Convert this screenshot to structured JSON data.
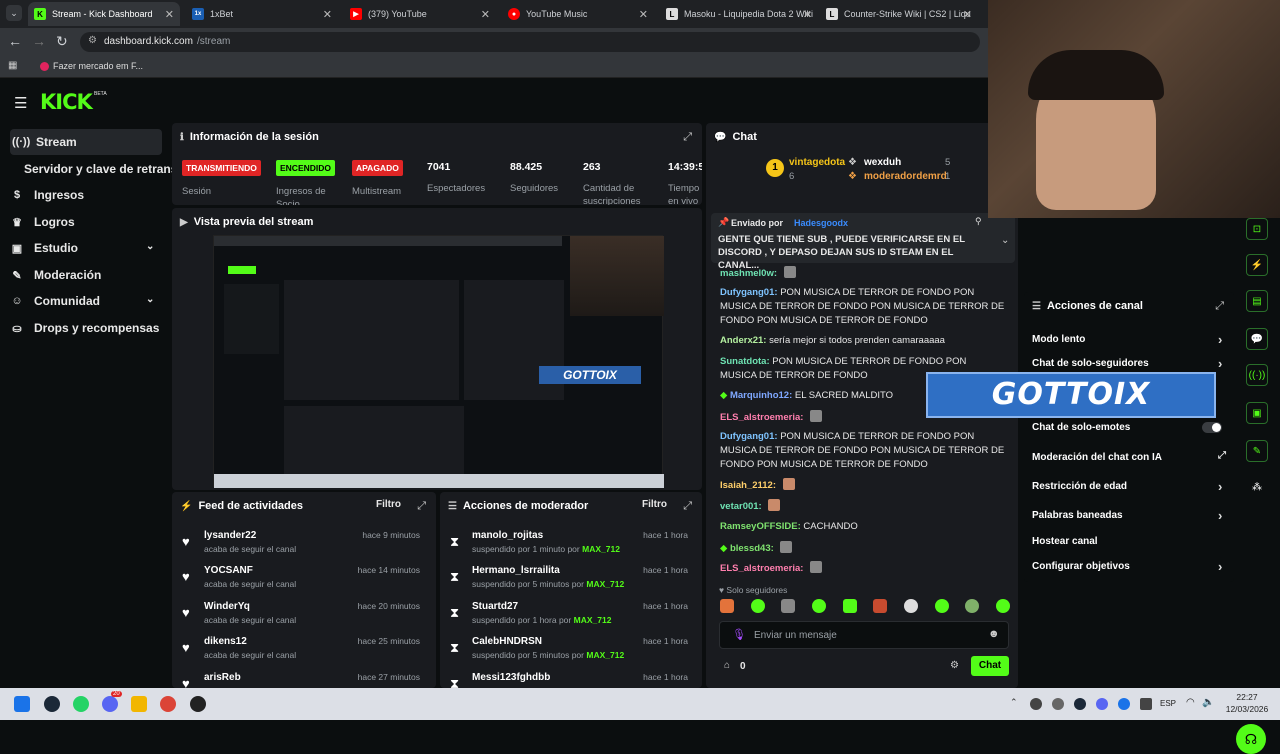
{
  "browser": {
    "tabs": [
      {
        "label": "Stream - Kick Dashboard",
        "fav_color": "#53fc18",
        "fav": "K"
      },
      {
        "label": "1xBet",
        "fav_color": "#1a5fb4",
        "fav": "1x"
      },
      {
        "label": "(379) YouTube",
        "fav_color": "#ff0000",
        "fav": "▶"
      },
      {
        "label": "YouTube Music",
        "fav_color": "#ff0000",
        "fav": "●"
      },
      {
        "label": "Masoku - Liquipedia Dota 2 Wiki",
        "fav_color": "#ddd",
        "fav": "L"
      },
      {
        "label": "Counter-Strike Wiki | CS2 | Liqu",
        "fav_color": "#ddd",
        "fav": "L"
      }
    ],
    "address_host": "dashboard.kick.com",
    "address_path": "/stream",
    "bookmark": "Fazer mercado em F..."
  },
  "brand": {
    "logo": "KICK",
    "beta": "BETA"
  },
  "sidebar": {
    "items": [
      {
        "label": "Stream",
        "icon": "radio-icon"
      },
      {
        "label": "Servidor y clave de retransmisión"
      },
      {
        "label": "Ingresos",
        "icon": "money-icon"
      },
      {
        "label": "Logros",
        "icon": "trophy-icon"
      },
      {
        "label": "Estudio",
        "icon": "studio-icon"
      },
      {
        "label": "Moderación",
        "icon": "wrench-icon"
      },
      {
        "label": "Comunidad",
        "icon": "community-icon"
      },
      {
        "label": "Drops y recompensas",
        "icon": "drops-icon"
      }
    ]
  },
  "session": {
    "title": "Información de la sesión",
    "badges": [
      {
        "label": "TRANSMITIENDO",
        "sub": "Sesión",
        "bg": "#e02525",
        "fg": "#ffffff"
      },
      {
        "label": "ENCENDIDO",
        "sub": "Ingresos de Socio",
        "bg": "#53fc18",
        "fg": "#000000"
      },
      {
        "label": "APAGADO",
        "sub": "Multistream",
        "bg": "#e02525",
        "fg": "#ffffff"
      }
    ],
    "stats": [
      {
        "value": "7041",
        "label": "Espectadores"
      },
      {
        "value": "88.425",
        "label": "Seguidores"
      },
      {
        "value": "263",
        "label": "Cantidad de suscripciones"
      },
      {
        "value": "14:39:5",
        "label": "Tiempo en vivo"
      }
    ]
  },
  "preview": {
    "title": "Vista previa del stream",
    "overlay": "GOTTOIX"
  },
  "feed": {
    "title": "Feed de actividades",
    "filter": "Filtro",
    "rows": [
      {
        "name": "lysander22",
        "sub": "acaba de seguir el canal",
        "time": "hace 9 minutos"
      },
      {
        "name": "YOCSANF",
        "sub": "acaba de seguir el canal",
        "time": "hace 14 minutos"
      },
      {
        "name": "WinderYq",
        "sub": "acaba de seguir el canal",
        "time": "hace 20 minutos"
      },
      {
        "name": "dikens12",
        "sub": "acaba de seguir el canal",
        "time": "hace 25 minutos"
      },
      {
        "name": "arisReb",
        "sub": "",
        "time": "hace 27 minutos"
      }
    ]
  },
  "mod": {
    "title": "Acciones de moderador",
    "filter": "Filtro",
    "rows": [
      {
        "name": "manolo_rojitas",
        "sub": "suspendido por 1 minuto por",
        "by": "MAX_712",
        "time": "hace 1 hora"
      },
      {
        "name": "Hermano_lsrrailita",
        "sub": "suspendido por 5 minutos por",
        "by": "MAX_712",
        "time": "hace 1 hora"
      },
      {
        "name": "Stuartd27",
        "sub": "suspendido por 1 hora por",
        "by": "MAX_712",
        "time": "hace 1 hora"
      },
      {
        "name": "CalebHNDRSN",
        "sub": "suspendido por 5 minutos por",
        "by": "MAX_712",
        "time": "hace 1 hora"
      },
      {
        "name": "Messi123fghdbb",
        "sub": "",
        "by": "",
        "time": "hace 1 hora"
      }
    ]
  },
  "chat": {
    "title": "Chat",
    "top": {
      "rank": "1",
      "user1": "vintagedota",
      "user1_count": "6",
      "user2": "wexduh",
      "user2_count": "5",
      "user3": "moderadordemrd",
      "user3_count": "1"
    },
    "pinned": {
      "by_label": "Enviado por",
      "by_user": "Hadesgoodx",
      "text": "GENTE QUE TIENE SUB , PUEDE VERIFICARSE EN EL DISCORD , Y DEPASO DEJAN SUS ID STEAM EN EL CANAL..."
    },
    "messages": [
      {
        "user": "mashmel0w:",
        "color": "#6fe3b3",
        "text": ""
      },
      {
        "user": "Dufygang01:",
        "color": "#7fc4ff",
        "text": "PON MUSICA DE TERROR DE FONDO  PON MUSICA DE TERROR DE FONDO  PON MUSICA DE TERROR DE FONDO  PON MUSICA DE TERROR DE FONDO"
      },
      {
        "user": "Anderx21:",
        "color": "#b4f0a0",
        "text": "sería mejor si todos prenden camaraaaaa"
      },
      {
        "user": "Sunatdota:",
        "color": "#6fe3b3",
        "text": "PON MUSICA DE TERROR DE FONDO    PON MUSICA DE TERROR DE FONDO"
      },
      {
        "user": "Marquinho12:",
        "color": "#7fa8ff",
        "text": "EL SACRED MALDITO"
      },
      {
        "user": "ELS_alstroemeria:",
        "color": "#ff7fae",
        "text": ""
      },
      {
        "user": "Dufygang01:",
        "color": "#7fc4ff",
        "text": "PON MUSICA DE TERROR DE FONDO  PON MUSICA DE TERROR DE FONDO  PON MUSICA DE TERROR DE FONDO  PON MUSICA DE TERROR DE FONDO"
      },
      {
        "user": "Isaiah_2112:",
        "color": "#ffcf6a",
        "text": ""
      },
      {
        "user": "vetar001:",
        "color": "#6fe3b3",
        "text": ""
      },
      {
        "user": "RamseyOFFSIDE:",
        "color": "#7fe36f",
        "text": "CACHANDO"
      },
      {
        "user": "blessd43:",
        "color": "#7fe36f",
        "text": ""
      },
      {
        "user": "ELS_alstroemeria:",
        "color": "#ff7fae",
        "text": ""
      }
    ],
    "followers_only": "Solo seguidores",
    "input_placeholder": "Enviar un mensaje",
    "points": "0",
    "send": "Chat"
  },
  "channel_actions": {
    "title": "Acciones de canal",
    "rows": [
      {
        "label": "Modo lento",
        "chevron": true
      },
      {
        "label": "Chat de solo-seguidores",
        "chevron": true
      },
      {
        "label": "Chat de solo-emotes",
        "toggle": true
      },
      {
        "label": "Moderación del chat con IA",
        "external": true
      },
      {
        "label": "Restricción de edad",
        "chevron": true
      },
      {
        "label": "Palabras baneadas",
        "chevron": true
      },
      {
        "label": "Hostear canal"
      },
      {
        "label": "Configurar objetivos",
        "chevron": true
      }
    ],
    "overlay": "GOTTOIX"
  },
  "taskbar": {
    "lang": "ESP",
    "time": "22:27",
    "date": "12/03/2026",
    "badge": "20"
  },
  "colors": {
    "accent": "#53fc18",
    "bg": "#0b0e0f",
    "panel": "#191b1f"
  }
}
